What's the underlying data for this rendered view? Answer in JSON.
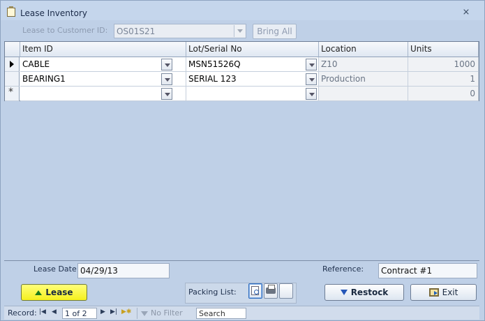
{
  "window": {
    "title": "Lease Inventory",
    "close_glyph": "⨯"
  },
  "customer": {
    "label": "Lease to Customer ID:",
    "value": "OS01S21",
    "bring_all_label": "Bring All"
  },
  "grid": {
    "columns": [
      "Item ID",
      "Lot/Serial No",
      "Location",
      "Units"
    ],
    "rows": [
      {
        "item_id": "CABLE",
        "lot_serial": "MSN51526Q",
        "location": "Z10",
        "units": "1000"
      },
      {
        "item_id": "BEARING1",
        "lot_serial": "SERIAL 123",
        "location": "Production",
        "units": "1"
      }
    ],
    "new_row": {
      "units": "0"
    }
  },
  "footer": {
    "lease_date_label": "Lease Date:",
    "lease_date": "04/29/13",
    "reference_label": "Reference:",
    "reference": "Contract #1",
    "lease_button": "Lease",
    "packing_list_label": "Packing List:",
    "restock_button": "Restock",
    "exit_button": "Exit"
  },
  "navigation": {
    "record_label": "Record:",
    "record_position": "1 of 2",
    "filter_label": "No Filter",
    "search_placeholder": "Search"
  },
  "colors": {
    "lease_button": "#f5f01e",
    "background": "#bfd0e7"
  }
}
